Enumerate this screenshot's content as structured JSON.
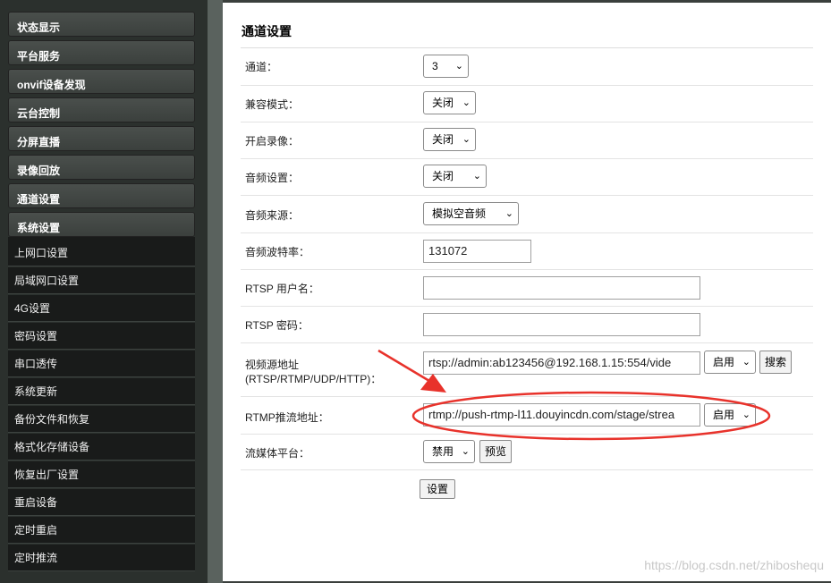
{
  "sidebar": {
    "groups": [
      "状态显示",
      "平台服务",
      "onvif设备发现",
      "云台控制",
      "分屏直播",
      "录像回放",
      "通道设置",
      "系统设置"
    ],
    "sub_items": [
      "上网口设置",
      "局域网口设置",
      "4G设置",
      "密码设置",
      "串口透传",
      "系统更新",
      "备份文件和恢复",
      "格式化存储设备",
      "恢复出厂设置",
      "重启设备",
      "定时重启",
      "定时推流"
    ]
  },
  "main": {
    "title": "通道设置",
    "fields": {
      "channel": {
        "label": "通道：",
        "value": "3"
      },
      "compat": {
        "label": "兼容模式：",
        "value": "关闭"
      },
      "record": {
        "label": "开启录像：",
        "value": "关闭"
      },
      "audio": {
        "label": "音频设置：",
        "value": "关闭"
      },
      "audio_source": {
        "label": "音频来源：",
        "value": "模拟空音频"
      },
      "audio_bitrate": {
        "label": "音频波特率：",
        "value": "131072"
      },
      "rtsp_user": {
        "label": "RTSP 用户名：",
        "value": ""
      },
      "rtsp_pass": {
        "label": "RTSP 密码：",
        "value": ""
      },
      "video_src": {
        "label_line1": "视频源地址",
        "label_line2": "(RTSP/RTMP/UDP/HTTP)：",
        "value": "rtsp://admin:ab123456@192.168.1.15:554/vide",
        "enable": "启用",
        "search": "搜索"
      },
      "rtmp": {
        "label": "RTMP推流地址：",
        "value": "rtmp://push-rtmp-l11.douyincdn.com/stage/strea",
        "enable": "启用"
      },
      "stream_platform": {
        "label": "流媒体平台：",
        "value": "禁用",
        "preview": "预览"
      }
    },
    "submit": "设置"
  },
  "watermark": "https://blog.csdn.net/zhiboshequ",
  "colors": {
    "annotation": "#e8322b",
    "sidebar_bg": "#2b302d",
    "sub_item_bg": "#191b1a"
  }
}
